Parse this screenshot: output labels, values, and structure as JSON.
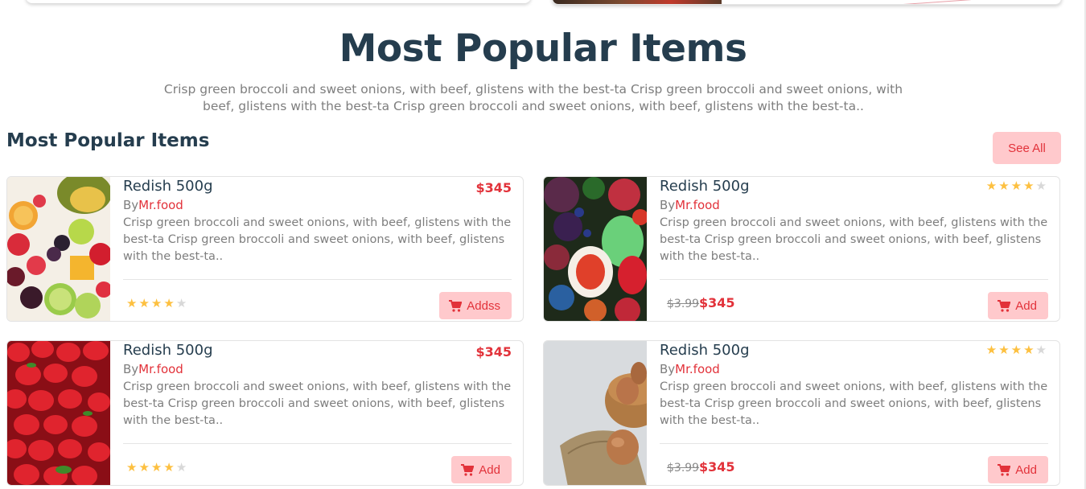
{
  "hero": {
    "title": "Most Popular Items",
    "description": "Crisp green broccoli and sweet onions, with beef, glistens with the best-ta Crisp green broccoli and sweet onions, with beef, glistens with the best-ta Crisp green broccoli and sweet onions, with beef, glistens with the best-ta.."
  },
  "section": {
    "title": "Most Popular Items",
    "see_all_label": "See All"
  },
  "products": [
    {
      "name": "Redish 500g",
      "by_prefix": "By",
      "vendor": "Mr.food",
      "price": "$345",
      "description": "Crisp green broccoli and sweet onions, with beef, glistens with the best-ta Crisp green broccoli and sweet onions, with beef, glistens with the best-ta..",
      "rating": 4,
      "rating_max": 5,
      "add_label": "Addss",
      "image": "mixed fruit platter"
    },
    {
      "name": "Redish 500g",
      "by_prefix": "By",
      "vendor": "Mr.food",
      "old_price": "$3.99",
      "price": "$345",
      "description": "Crisp green broccoli and sweet onions, with beef, glistens with the best-ta Crisp green broccoli and sweet onions, with beef, glistens with the best-ta..",
      "rating": 4,
      "rating_max": 5,
      "add_label": "Add",
      "image": "assorted tropical fruits"
    },
    {
      "name": "Redish 500g",
      "by_prefix": "By",
      "vendor": "Mr.food",
      "price": "$345",
      "description": "Crisp green broccoli and sweet onions, with beef, glistens with the best-ta Crisp green broccoli and sweet onions, with beef, glistens with the best-ta..",
      "rating": 4,
      "rating_max": 5,
      "add_label": "Add",
      "image": "strawberries"
    },
    {
      "name": "Redish 500g",
      "by_prefix": "By",
      "vendor": "Mr.food",
      "old_price": "$3.99",
      "price": "$345",
      "description": "Crisp green broccoli and sweet onions, with beef, glistens with the best-ta Crisp green broccoli and sweet onions, with beef, glistens with the best-ta..",
      "rating": 4,
      "rating_max": 5,
      "add_label": "Add",
      "image": "brown eggs in bowl"
    }
  ],
  "icons": {
    "cart": "cart-icon",
    "star": "star-icon"
  },
  "colors": {
    "accent": "#e2323a",
    "accent_bg": "#ffc9cc",
    "heading": "#253d4e",
    "muted": "#7e7e7e",
    "star": "#fdc040"
  }
}
